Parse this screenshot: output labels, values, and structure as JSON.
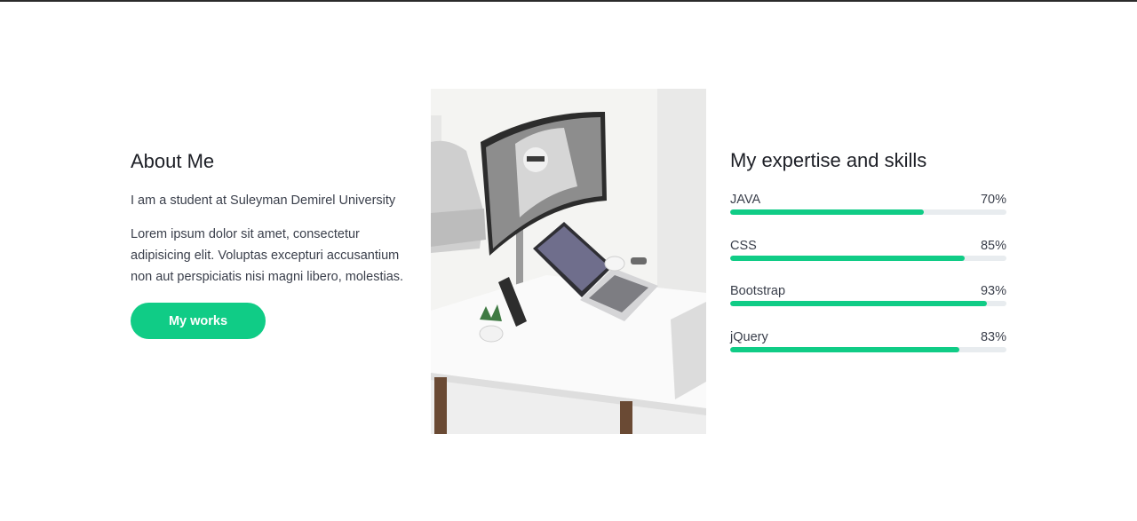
{
  "about": {
    "title": "About Me",
    "lead": "I am a student at Suleyman Demirel University",
    "body": "Lorem ipsum dolor sit amet, consectetur adipisicing elit. Voluptas excepturi accusantium non aut perspiciatis nisi magni libero, molestias.",
    "button_label": "My works"
  },
  "skills": {
    "title": "My expertise and skills",
    "items": [
      {
        "name": "JAVA",
        "percent_label": "70%",
        "level": 0.7
      },
      {
        "name": "CSS",
        "percent_label": "85%",
        "level": 0.85
      },
      {
        "name": "Bootstrap",
        "percent_label": "93%",
        "level": 0.93
      },
      {
        "name": "jQuery",
        "percent_label": "83%",
        "level": 0.83
      }
    ]
  },
  "colors": {
    "accent": "#10cc86",
    "track": "#e8ecef",
    "text": "#3a3f4b"
  }
}
